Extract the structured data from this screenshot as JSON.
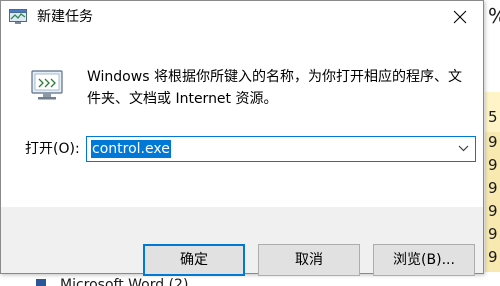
{
  "dialog": {
    "title": "新建任务",
    "description": "Windows 将根据你所键入的名称，为你打开相应的程序、文件夹、文档或 Internet 资源。",
    "open_label": "打开(O):",
    "input_value": "control.exe",
    "buttons": {
      "ok": "确定",
      "cancel": "取消",
      "browse": "浏览(B)..."
    }
  },
  "background": {
    "percent_top": "%",
    "digits": [
      "5",
      "9",
      "9",
      "9",
      "9",
      "9",
      "9"
    ],
    "bottom_item": "Microsoft Word (2)"
  },
  "colors": {
    "accent": "#0078d7",
    "dialog_bg": "#f0f0f0",
    "button_bg": "#e1e1e1"
  },
  "icons": [
    "task-manager-icon",
    "close-icon",
    "run-dialog-icon",
    "dropdown-arrow-icon",
    "word-icon"
  ]
}
